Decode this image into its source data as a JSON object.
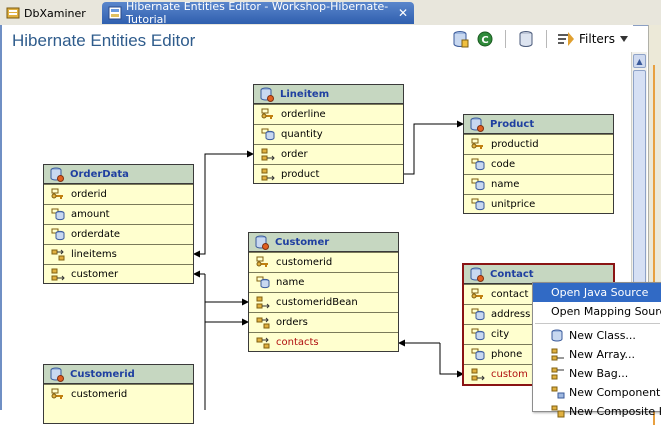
{
  "tabs": [
    {
      "label": "DbXaminer",
      "active": false
    },
    {
      "label": "Hibernate Entities Editor - Workshop-Hibernate-Tutorial",
      "active": true
    }
  ],
  "tab_close_glyph": "✕",
  "editor_title": "Hibernate Entities Editor",
  "toolbar": {
    "filters_label": "Filters"
  },
  "entities": {
    "lineitem": {
      "name": "Lineitem",
      "fields": [
        {
          "label": "orderline",
          "icon": "key-field-icon"
        },
        {
          "label": "quantity",
          "icon": "property-icon"
        },
        {
          "label": "order",
          "icon": "relation-icon"
        },
        {
          "label": "product",
          "icon": "relation-icon"
        }
      ]
    },
    "product": {
      "name": "Product",
      "fields": [
        {
          "label": "productid",
          "icon": "key-field-icon"
        },
        {
          "label": "code",
          "icon": "property-icon"
        },
        {
          "label": "name",
          "icon": "property-icon"
        },
        {
          "label": "unitprice",
          "icon": "property-icon"
        }
      ]
    },
    "orderdata": {
      "name": "OrderData",
      "fields": [
        {
          "label": "orderid",
          "icon": "key-field-icon"
        },
        {
          "label": "amount",
          "icon": "property-icon"
        },
        {
          "label": "orderdate",
          "icon": "property-icon"
        },
        {
          "label": "lineitems",
          "icon": "collection-icon"
        },
        {
          "label": "customer",
          "icon": "relation-icon"
        }
      ]
    },
    "customer": {
      "name": "Customer",
      "fields": [
        {
          "label": "customerid",
          "icon": "key-field-icon"
        },
        {
          "label": "name",
          "icon": "property-icon"
        },
        {
          "label": "customeridBean",
          "icon": "relation-icon"
        },
        {
          "label": "orders",
          "icon": "collection-icon"
        },
        {
          "label": "contacts",
          "icon": "collection-icon"
        }
      ]
    },
    "contact": {
      "name": "Contact",
      "fields": [
        {
          "label": "contact",
          "icon": "key-field-icon"
        },
        {
          "label": "address",
          "icon": "property-icon"
        },
        {
          "label": "city",
          "icon": "property-icon"
        },
        {
          "label": "phone",
          "icon": "property-icon"
        },
        {
          "label": "custom",
          "icon": "relation-icon"
        }
      ]
    },
    "customerid": {
      "name": "Customerid",
      "fields": [
        {
          "label": "customerid",
          "icon": "key-field-icon"
        }
      ]
    }
  },
  "context_menu": {
    "open_java_source": "Open Java Source",
    "open_mapping_source": "Open Mapping Source",
    "new_class": "New Class...",
    "new_array": "New Array...",
    "new_bag": "New Bag...",
    "new_component": "New Component...",
    "new_composite": "New Composite Id"
  },
  "colors": {
    "entity_body": "#ffffcf",
    "entity_header": "#c6d7c1",
    "entity_title": "#1f3fa0",
    "selected_border": "#8a1414",
    "menu_highlight": "#316ac5",
    "tab_active": "#3d6cbb"
  }
}
